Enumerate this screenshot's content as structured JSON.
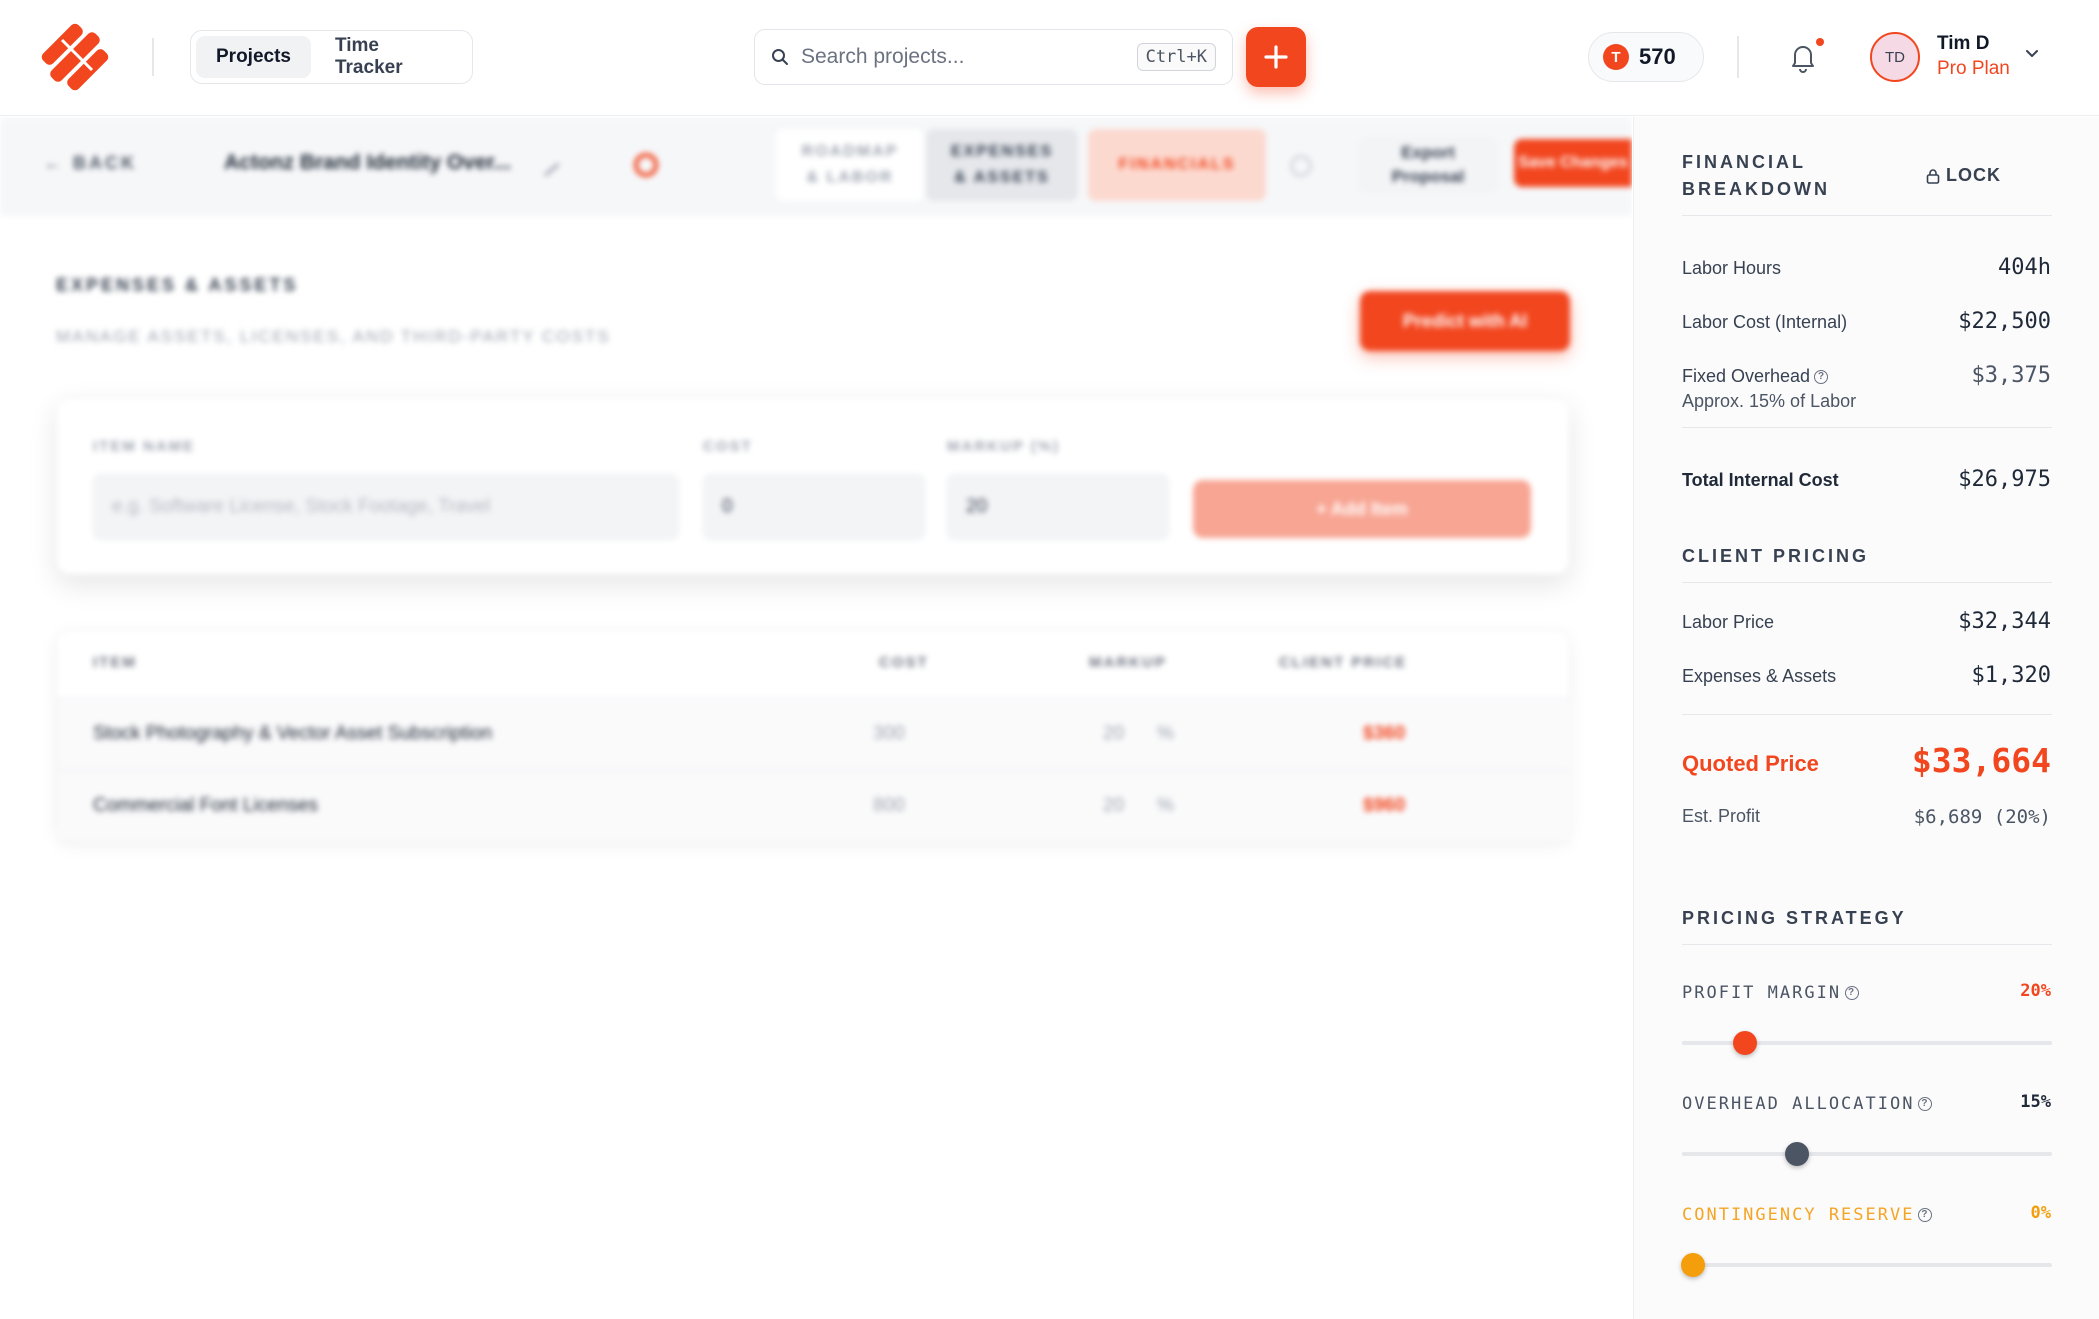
{
  "topbar": {
    "nav": [
      {
        "label": "Projects",
        "active": true
      },
      {
        "label": "Time Tracker",
        "active": false
      }
    ],
    "search": {
      "placeholder": "Search projects...",
      "shortcut": "Ctrl+K"
    },
    "points": {
      "coin_letter": "T",
      "value": "570"
    },
    "user": {
      "initials": "TD",
      "name": "Tim D",
      "plan": "Pro Plan"
    },
    "accent_color": "#f2461f"
  },
  "workspace": {
    "back_label": "BACK",
    "project_title": "Actonz Brand Identity Over...",
    "tabs": [
      {
        "line1": "ROADMAP",
        "line2": "& LABOR"
      },
      {
        "line1": "EXPENSES",
        "line2": "& ASSETS"
      },
      {
        "line1": "FINANCIALS",
        "line2": ""
      }
    ],
    "export_line1": "Export",
    "export_line2": "Proposal",
    "save_label": "Save Changes",
    "section_title": "EXPENSES & ASSETS",
    "section_subtitle": "MANAGE ASSETS, LICENSES, AND THIRD-PARTY COSTS",
    "predict_label": "Predict with AI",
    "form": {
      "item_label": "ITEM NAME",
      "item_placeholder": "e.g. Software License, Stock Footage, Travel",
      "cost_label": "COST",
      "cost_value": "0",
      "markup_label": "MARKUP (%)",
      "markup_value": "20",
      "add_label": "+  Add Item"
    },
    "table": {
      "headers": [
        "ITEM",
        "COST",
        "MARKUP",
        "CLIENT PRICE"
      ],
      "rows": [
        {
          "item": "Stock Photography & Vector Asset Subscription",
          "cost": "300",
          "markup": "20",
          "unit": "%",
          "price": "$360"
        },
        {
          "item": "Commercial Font Licenses",
          "cost": "800",
          "markup": "20",
          "unit": "%",
          "price": "$960"
        }
      ]
    }
  },
  "panel": {
    "breakdown_title_1": "FINANCIAL",
    "breakdown_title_2": "BREAKDOWN",
    "lock_label": "LOCK",
    "labor_hours_label": "Labor Hours",
    "labor_hours_value": "404h",
    "labor_cost_label": "Labor Cost (Internal)",
    "labor_cost_value": "$22,500",
    "overhead_label": "Fixed Overhead",
    "overhead_value": "$3,375",
    "overhead_note": "Approx. 15% of Labor",
    "total_label": "Total Internal Cost",
    "total_value": "$26,975",
    "client_title": "CLIENT PRICING",
    "labor_price_label": "Labor Price",
    "labor_price_value": "$32,344",
    "expenses_label": "Expenses & Assets",
    "expenses_value": "$1,320",
    "quoted_label": "Quoted Price",
    "quoted_value": "$33,664",
    "profit_label": "Est. Profit",
    "profit_value": "$6,689 (20%)",
    "strategy_title": "PRICING STRATEGY",
    "sliders": [
      {
        "label": "PROFIT MARGIN",
        "pct_text": "20%",
        "value": 0.17,
        "color": "#f2461f",
        "label_color": "#4b5563",
        "pct_color": "#f2461f"
      },
      {
        "label": "OVERHEAD ALLOCATION",
        "pct_text": "15%",
        "value": 0.31,
        "color": "#4b5563",
        "label_color": "#4b5563",
        "pct_color": "#1f2937"
      },
      {
        "label": "CONTINGENCY RESERVE",
        "pct_text": "0%",
        "value": 0.03,
        "color": "#f59e0b",
        "label_color": "#f5a524",
        "pct_color": "#f59e0b"
      }
    ]
  }
}
